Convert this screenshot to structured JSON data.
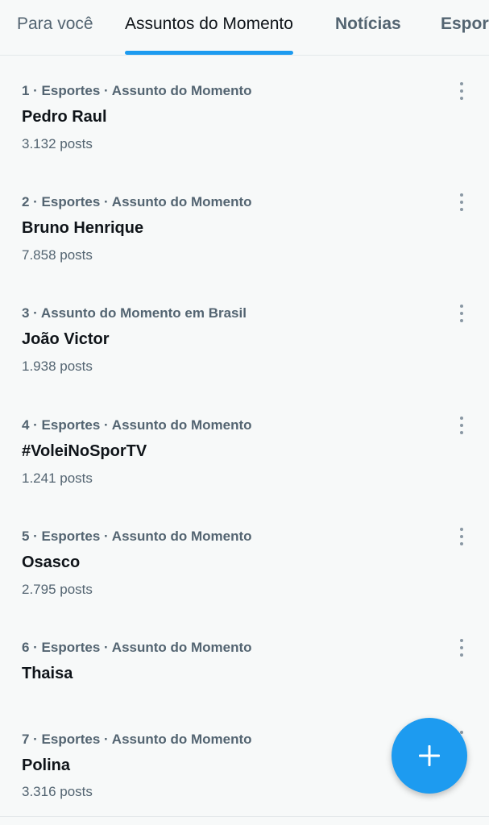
{
  "tabs": [
    {
      "label": "Para você"
    },
    {
      "label": "Assuntos do Momento"
    },
    {
      "label": "Notícias"
    },
    {
      "label": "Esportes"
    }
  ],
  "trends": [
    {
      "meta": "1 · Esportes · Assunto do Momento",
      "name": "Pedro Raul",
      "count": "3.132 posts"
    },
    {
      "meta": "2 · Esportes · Assunto do Momento",
      "name": "Bruno Henrique",
      "count": "7.858 posts"
    },
    {
      "meta": "3 · Assunto do Momento em Brasil",
      "name": "João Victor",
      "count": "1.938 posts"
    },
    {
      "meta": "4 · Esportes · Assunto do Momento",
      "name": "#VoleiNoSporTV",
      "count": "1.241 posts"
    },
    {
      "meta": "5 · Esportes · Assunto do Momento",
      "name": "Osasco",
      "count": "2.795 posts"
    },
    {
      "meta": "6 · Esportes · Assunto do Momento",
      "name": "Thaisa",
      "count": ""
    },
    {
      "meta": "7 · Esportes · Assunto do Momento",
      "name": "Polina",
      "count": "3.316 posts"
    }
  ],
  "icons": {
    "more": "more-vertical-icon",
    "compose": "plus-icon"
  },
  "colors": {
    "accent": "#1d9bf0",
    "text_primary": "#0f1419",
    "text_secondary": "#536471"
  }
}
